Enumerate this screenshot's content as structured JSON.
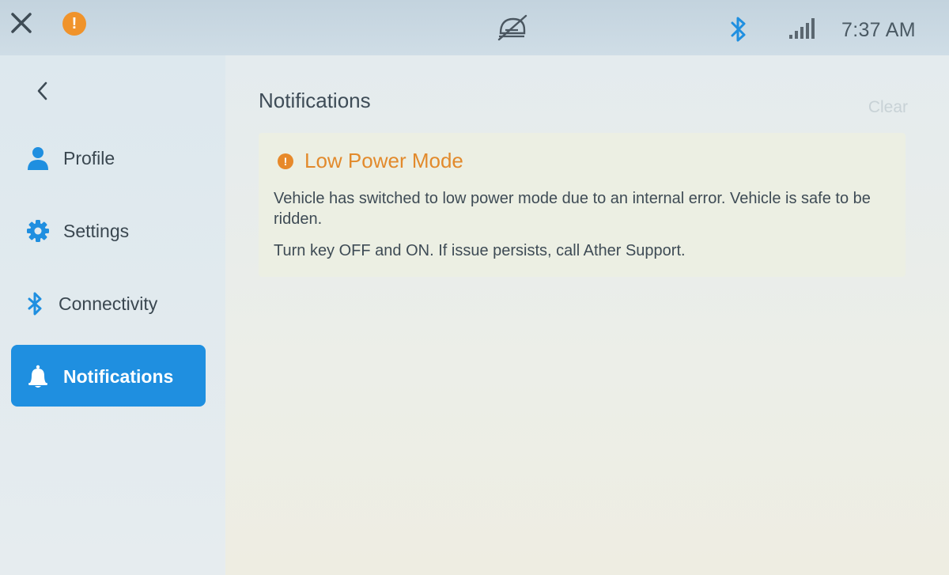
{
  "status_bar": {
    "time": "7:37 AM",
    "icons": [
      "close-icon",
      "alert-icon",
      "helmet-off-icon",
      "bluetooth-icon",
      "signal-strength-icon"
    ],
    "alert_color": "#f0932b",
    "bluetooth_color": "#1f8fe0"
  },
  "sidebar": {
    "back_icon": "chevron-left-icon",
    "items": [
      {
        "label": "Profile",
        "icon": "person-icon",
        "active": false
      },
      {
        "label": "Settings",
        "icon": "gear-icon",
        "active": false
      },
      {
        "label": "Connectivity",
        "icon": "bluetooth-icon",
        "active": false
      },
      {
        "label": "Notifications",
        "icon": "bell-icon",
        "active": true
      }
    ],
    "active_color": "#1f8fe0"
  },
  "main": {
    "title": "Notifications",
    "clear_label": "Clear",
    "notifications": [
      {
        "title": "Low Power Mode",
        "icon": "warning-icon",
        "body": "Vehicle has switched to low power mode due to an internal error. Vehicle is safe to be ridden.",
        "action": "Turn key OFF and ON. If issue persists, call Ather Support.",
        "accent_color": "#e28a2c"
      }
    ]
  }
}
